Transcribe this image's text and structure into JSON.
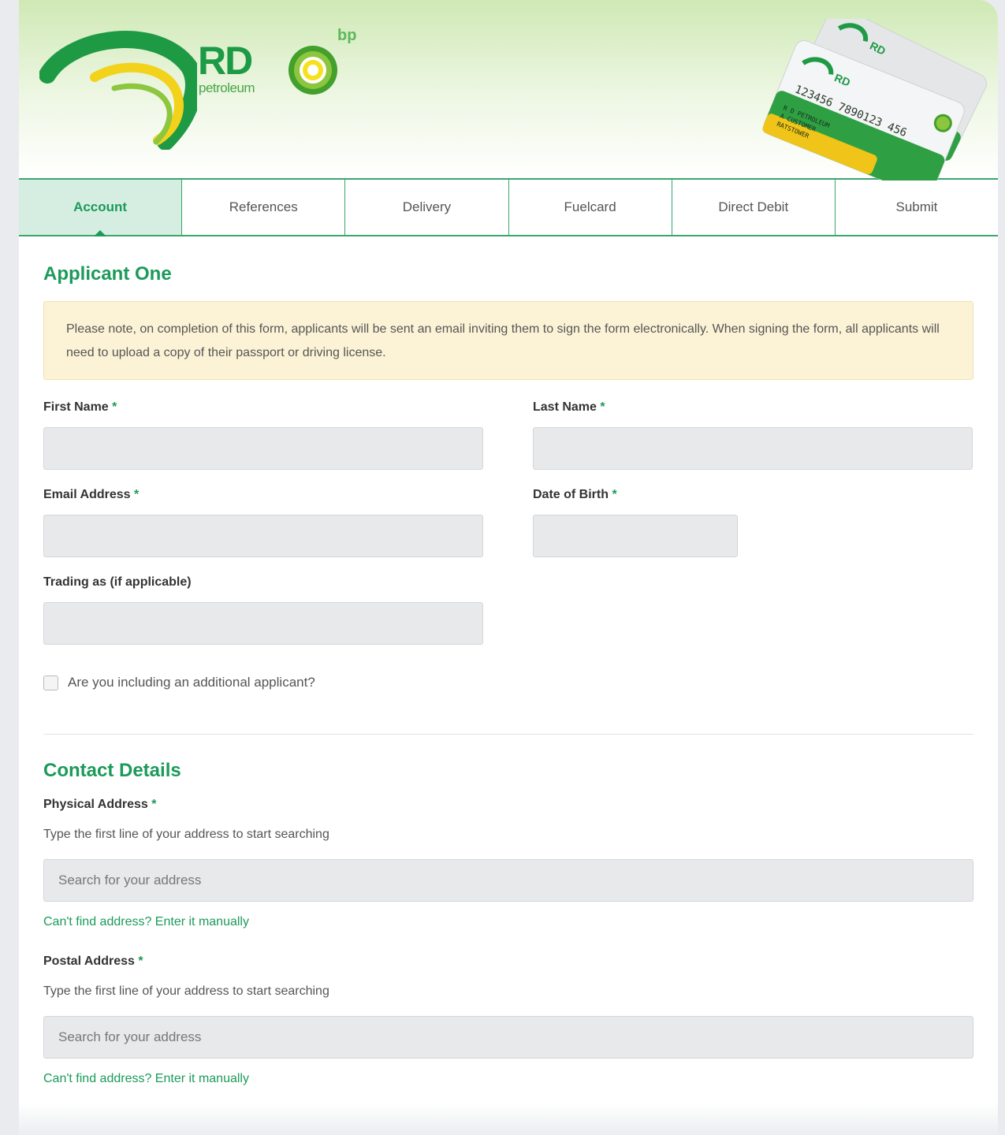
{
  "header": {
    "logo_text": "RD",
    "logo_subtext": "petroleum",
    "partner_text": "bp",
    "card_number": "123456 7890123 456",
    "card_holder_lines": [
      "R D PETROLEUM",
      "A CUSTOMER",
      "RATSTOWER"
    ],
    "card_logo": "RD"
  },
  "tabs": [
    {
      "label": "Account",
      "active": true
    },
    {
      "label": "References",
      "active": false
    },
    {
      "label": "Delivery",
      "active": false
    },
    {
      "label": "Fuelcard",
      "active": false
    },
    {
      "label": "Direct Debit",
      "active": false
    },
    {
      "label": "Submit",
      "active": false
    }
  ],
  "applicant": {
    "title": "Applicant One",
    "notice": "Please note, on completion of this form, applicants will be sent an email inviting them to sign the form electronically. When signing the form, all applicants will need to upload a copy of their passport or driving license.",
    "first_name_label": "First Name",
    "last_name_label": "Last Name",
    "email_label": "Email Address",
    "dob_label": "Date of Birth",
    "trading_label": "Trading as (if applicable)",
    "required_mark": "*",
    "additional_applicant_label": "Are you including an additional applicant?"
  },
  "contact": {
    "title": "Contact Details",
    "physical_label": "Physical Address",
    "physical_help": "Type the first line of your address to start searching",
    "physical_placeholder": "Search for your address",
    "physical_link": "Can't find address? Enter it manually",
    "postal_label": "Postal Address",
    "postal_help": "Type the first line of your address to start searching",
    "postal_placeholder": "Search for your address",
    "postal_link": "Can't find address? Enter it manually"
  },
  "colors": {
    "brand_green": "#1b9a5a",
    "tab_active_bg": "#d6eee2",
    "notice_bg": "#fcf3d6",
    "input_bg": "#e8e9eb"
  }
}
